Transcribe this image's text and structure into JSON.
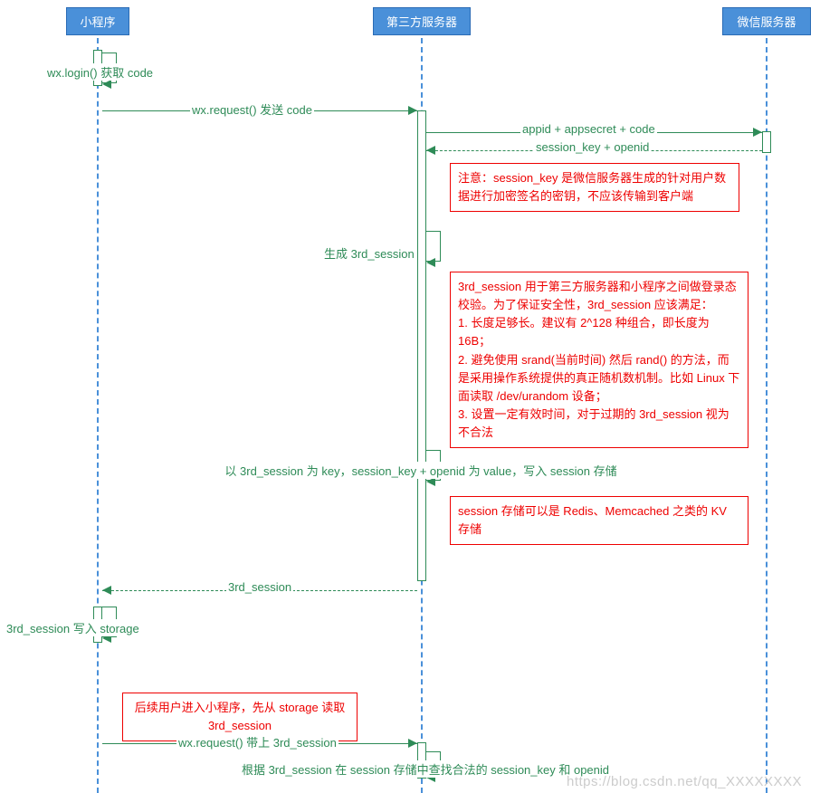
{
  "participants": {
    "miniprogram": "小程序",
    "third_server": "第三方服务器",
    "wechat_server": "微信服务器"
  },
  "messages": {
    "wx_login": "wx.login() 获取 code",
    "wx_request_code": "wx.request() 发送 code",
    "appid_secret": "appid + appsecret + code",
    "session_key_openid": "session_key + openid",
    "gen_3rd": "生成 3rd_session",
    "write_session_store": "以 3rd_session 为 key，session_key + openid 为 value，写入 session 存储",
    "return_3rd": "3rd_session",
    "write_storage": "3rd_session 写入 storage",
    "wx_request_3rd": "wx.request() 带上 3rd_session",
    "lookup_session": "根据 3rd_session 在 session 存储中查找合法的 session_key 和 openid"
  },
  "notes": {
    "note1": "注意：session_key 是微信服务器生成的针对用户数据进行加密签名的密钥，不应该传输到客户端",
    "note2_l1": "3rd_session 用于第三方服务器和小程序之间做登录态校验。为了保证安全性，3rd_session 应该满足：",
    "note2_l2": "1. 长度足够长。建议有 2^128 种组合，即长度为 16B；",
    "note2_l3": "2. 避免使用 srand(当前时间) 然后 rand() 的方法，而是采用操作系统提供的真正随机数机制。比如 Linux 下面读取 /dev/urandom 设备；",
    "note2_l4": "3. 设置一定有效时间，对于过期的 3rd_session 视为不合法",
    "note3": "session 存储可以是 Redis、Memcached 之类的 KV 存储",
    "note4": "后续用户进入小程序，先从 storage 读取 3rd_session"
  },
  "watermark": "https://blog.csdn.net/qq_XXXXXXXX",
  "chart_data": {
    "type": "sequence-diagram",
    "participants": [
      "小程序",
      "第三方服务器",
      "微信服务器"
    ],
    "events": [
      {
        "from": "小程序",
        "to": "小程序",
        "label": "wx.login() 获取 code",
        "kind": "self"
      },
      {
        "from": "小程序",
        "to": "第三方服务器",
        "label": "wx.request() 发送 code",
        "kind": "sync"
      },
      {
        "from": "第三方服务器",
        "to": "微信服务器",
        "label": "appid + appsecret + code",
        "kind": "sync"
      },
      {
        "from": "微信服务器",
        "to": "第三方服务器",
        "label": "session_key + openid",
        "kind": "return"
      },
      {
        "note_over": "第三方服务器",
        "text": "注意：session_key 是微信服务器生成的针对用户数据进行加密签名的密钥，不应该传输到客户端"
      },
      {
        "from": "第三方服务器",
        "to": "第三方服务器",
        "label": "生成 3rd_session",
        "kind": "self"
      },
      {
        "note_over": "第三方服务器",
        "text": "3rd_session 用于第三方服务器和小程序之间做登录态校验。为了保证安全性，3rd_session 应该满足：1. 长度足够长。建议有 2^128 种组合，即长度为 16B；2. 避免使用 srand(当前时间) 然后 rand() 的方法，而是采用操作系统提供的真正随机数机制。比如 Linux 下面读取 /dev/urandom 设备；3. 设置一定有效时间，对于过期的 3rd_session 视为不合法"
      },
      {
        "from": "第三方服务器",
        "to": "第三方服务器",
        "label": "以 3rd_session 为 key，session_key + openid 为 value，写入 session 存储",
        "kind": "self"
      },
      {
        "note_over": "第三方服务器",
        "text": "session 存储可以是 Redis、Memcached 之类的 KV 存储"
      },
      {
        "from": "第三方服务器",
        "to": "小程序",
        "label": "3rd_session",
        "kind": "return"
      },
      {
        "from": "小程序",
        "to": "小程序",
        "label": "3rd_session 写入 storage",
        "kind": "self"
      },
      {
        "note_over": "小程序",
        "text": "后续用户进入小程序，先从 storage 读取 3rd_session"
      },
      {
        "from": "小程序",
        "to": "第三方服务器",
        "label": "wx.request() 带上 3rd_session",
        "kind": "sync"
      },
      {
        "from": "第三方服务器",
        "to": "第三方服务器",
        "label": "根据 3rd_session 在 session 存储中查找合法的 session_key 和 openid",
        "kind": "self"
      }
    ]
  }
}
